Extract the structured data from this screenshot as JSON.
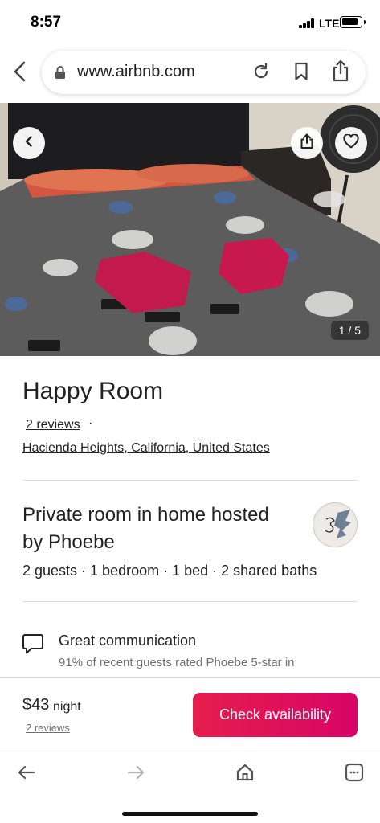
{
  "status_bar": {
    "time": "8:57",
    "network": "LTE"
  },
  "browser": {
    "url": "www.airbnb.com",
    "icons": [
      "back-chevron-icon",
      "lock-icon",
      "reload-icon",
      "bookmark-icon",
      "share-icon"
    ]
  },
  "hero": {
    "photo_counter": "1 / 5",
    "buttons": [
      "back-icon",
      "share-icon",
      "heart-icon"
    ]
  },
  "listing": {
    "title": "Happy Room",
    "reviews_link": "2 reviews",
    "separator": "·",
    "location": "Hacienda Heights, California, United States",
    "room_type": "Private room in home hosted by Phoebe",
    "room_stats": "2 guests · 1 bedroom · 1 bed · 2 shared baths"
  },
  "highlight": {
    "icon": "chat-bubble-icon",
    "title": "Great communication",
    "description": "91% of recent guests rated Phoebe 5-star in"
  },
  "booking": {
    "price": "$43",
    "unit": "night",
    "reviews": "2 reviews",
    "button_label": "Check availability"
  },
  "toolbar": {
    "icons": [
      "back-arrow-icon",
      "forward-arrow-icon",
      "home-icon",
      "tabs-icon"
    ]
  },
  "colors": {
    "accent": "#e61e4d",
    "text": "#222222",
    "muted": "#717171",
    "divider": "#dddddd"
  }
}
